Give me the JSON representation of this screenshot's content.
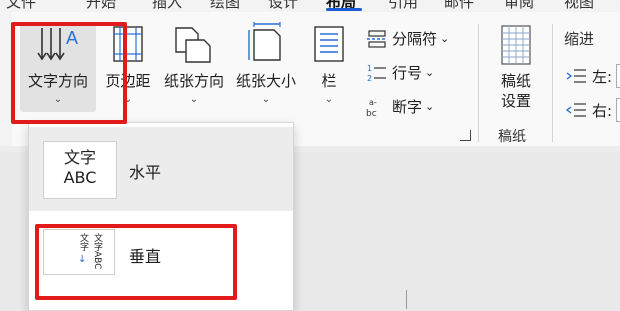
{
  "tabs": [
    {
      "label": "文件"
    },
    {
      "label": "开始"
    },
    {
      "label": "插入"
    },
    {
      "label": "绘图"
    },
    {
      "label": "设计"
    },
    {
      "label": "布局"
    },
    {
      "label": "引用"
    },
    {
      "label": "邮件"
    },
    {
      "label": "审阅"
    },
    {
      "label": "视图"
    }
  ],
  "active_tab": "布局",
  "ribbon": {
    "text_direction": {
      "label": "文字方向",
      "icon": "text-direction-icon"
    },
    "margins": {
      "label": "页边距",
      "icon": "margins-icon"
    },
    "orientation": {
      "label": "纸张方向",
      "icon": "orientation-icon"
    },
    "size": {
      "label": "纸张大小",
      "icon": "paper-size-icon"
    },
    "columns": {
      "label": "栏",
      "icon": "columns-icon"
    },
    "breaks": {
      "label": "分隔符",
      "icon": "breaks-icon"
    },
    "line_numbers": {
      "label": "行号",
      "icon": "line-numbers-icon"
    },
    "hyphenation": {
      "label": "断字",
      "icon": "hyphenation-icon"
    },
    "manuscript": {
      "label1": "稿纸",
      "label2": "设置",
      "group_label": "稿纸",
      "icon": "manuscript-icon"
    },
    "indent": {
      "title": "缩进",
      "left_label": "左:",
      "right_label": "右:"
    }
  },
  "menu": {
    "items": [
      {
        "label": "水平",
        "preview_text_1": "文字",
        "preview_text_2": "ABC"
      },
      {
        "label": "垂直",
        "preview_col_1": "文字",
        "preview_col_2": "文字ABC",
        "arrow": "↓"
      }
    ]
  },
  "colors": {
    "highlight": "#e11b1b",
    "accent": "#1a5bd6",
    "icon_blue": "#2a6fd6"
  }
}
